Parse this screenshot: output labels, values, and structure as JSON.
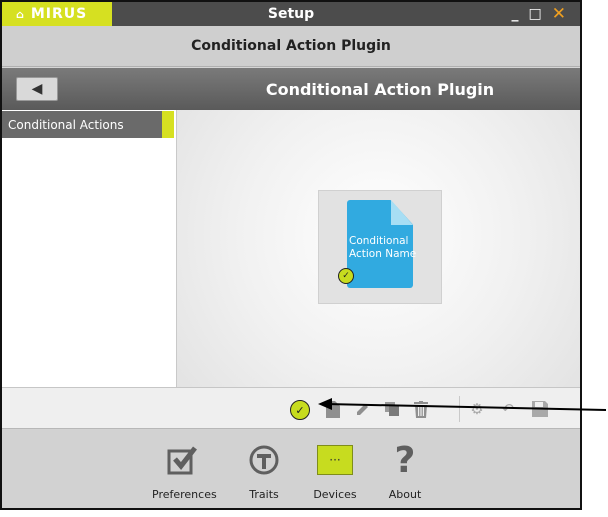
{
  "window": {
    "logo_text": "MIRUS",
    "title": "Setup",
    "minimize": "_",
    "maximize": "□",
    "close": "✕"
  },
  "subheader": {
    "title": "Conditional Action Plugin"
  },
  "navbar": {
    "back_icon": "◀",
    "title": "Conditional Action Plugin"
  },
  "sidebar": {
    "items": [
      {
        "label": "Conditional Actions"
      }
    ]
  },
  "tile": {
    "label": "Conditional Action Name"
  },
  "toolbar": {
    "icons": [
      "check-icon",
      "document-icon",
      "pencil-icon",
      "copy-icon",
      "trash-icon",
      "gear-icon",
      "undo-icon",
      "save-icon"
    ]
  },
  "bottom_nav": {
    "items": [
      {
        "label": "Preferences",
        "icon": "checkbox-icon"
      },
      {
        "label": "Traits",
        "icon": "traits-icon"
      },
      {
        "label": "Devices",
        "icon": "devices-icon"
      },
      {
        "label": "About",
        "icon": "question-icon"
      }
    ]
  },
  "colors": {
    "accent": "#d6e021",
    "titlebar": "#4c4c4c",
    "doc_blue": "#31aae0"
  }
}
